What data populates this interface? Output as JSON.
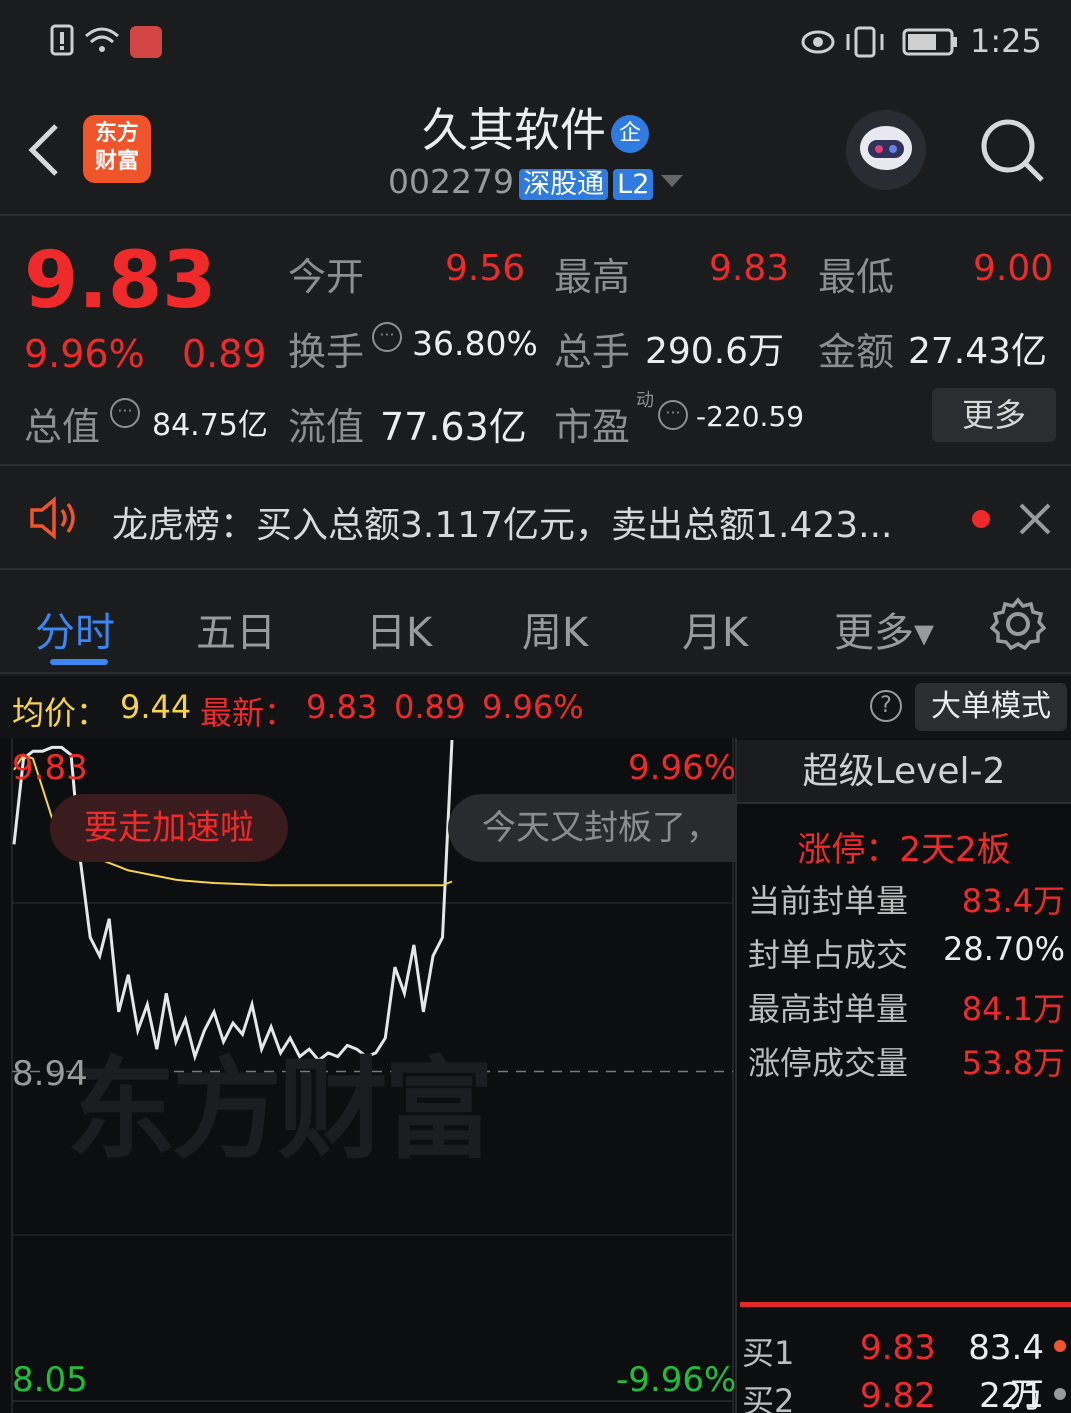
{
  "status_bar": {
    "time": "1:25"
  },
  "header": {
    "back_label": "<",
    "logo_text": [
      "东方",
      "财富"
    ],
    "stock_name": "久其软件",
    "enterprise_badge": "企",
    "stock_code": "002279",
    "connect_tag": "深股通",
    "level_tag": "L2"
  },
  "quote": {
    "price": "9.83",
    "change_pct": "9.96%",
    "change_amt": "0.89",
    "open_label": "今开",
    "open": "9.56",
    "high_label": "最高",
    "high": "9.83",
    "low_label": "最低",
    "low": "9.00",
    "turnover_label": "换手",
    "turnover": "36.80%",
    "volume_label": "总手",
    "volume": "290.6万",
    "amount_label": "金额",
    "amount": "27.43亿",
    "mcap_label": "总值",
    "mcap": "84.75亿",
    "float_label": "流值",
    "float": "77.63亿",
    "pe_label": "市盈",
    "pe_sup": "动",
    "pe": "-220.59",
    "more_button": "更多"
  },
  "news": {
    "text": "龙虎榜：买入总额3.117亿元，卖出总额1.423..."
  },
  "tabs": [
    "分时",
    "五日",
    "日K",
    "周K",
    "月K",
    "更多▾"
  ],
  "infobar": {
    "avg_label": "均价：",
    "avg": "9.44",
    "latest_label": "最新：",
    "latest": "9.83",
    "latest_chg": "0.89",
    "latest_pct": "9.96%",
    "help": "?",
    "big_order_button": "大单模式"
  },
  "chart": {
    "top_price": "9.83",
    "top_pct": "9.96%",
    "mid_price": "8.94",
    "bottom_price": "8.05",
    "bottom_pct": "-9.96%",
    "watermark": "东方财富",
    "bubble_left": "要走加速啦",
    "bubble_right": "今天又封板了，"
  },
  "chart_data": {
    "type": "line",
    "ylim": [
      8.05,
      9.83
    ],
    "series": [
      {
        "values": [
          9.55,
          9.78,
          9.8,
          9.8,
          9.81,
          9.81,
          9.79,
          9.5,
          9.3,
          9.25,
          9.35,
          9.1,
          9.2,
          9.05,
          9.12,
          9.0,
          9.15,
          9.02,
          9.08,
          8.98,
          9.05,
          9.1,
          9.02,
          9.07,
          9.04,
          9.12,
          9.0,
          9.06,
          8.99,
          9.03,
          8.98,
          9.0,
          8.97,
          8.99,
          8.98,
          9.01,
          9.0,
          8.98,
          8.99,
          9.03,
          9.22,
          9.15,
          9.28,
          9.1,
          9.25,
          9.3,
          9.83
        ]
      },
      {
        "values": [
          9.75,
          9.79,
          9.78,
          9.7,
          9.62,
          9.58,
          9.55,
          9.53,
          9.52,
          9.51,
          9.5,
          9.49,
          9.48,
          9.475,
          9.47,
          9.465,
          9.46,
          9.455,
          9.452,
          9.45,
          9.448,
          9.446,
          9.445,
          9.444,
          9.443,
          9.442,
          9.441,
          9.44,
          9.44,
          9.44,
          9.44,
          9.44,
          9.44,
          9.44,
          9.44,
          9.44,
          9.44,
          9.44,
          9.44,
          9.44,
          9.44,
          9.44,
          9.44,
          9.44,
          9.44,
          9.44,
          9.45
        ]
      }
    ]
  },
  "level2": {
    "title": "超级Level-2",
    "limit_label": "涨停：",
    "limit_value": "2天2板",
    "rows": [
      {
        "label": "当前封单量",
        "value": "83.4万"
      },
      {
        "label": "封单占成交",
        "value": "28.70%"
      },
      {
        "label": "最高封单量",
        "value": "84.1万"
      },
      {
        "label": "涨停成交量",
        "value": "53.8万"
      }
    ],
    "bids": [
      {
        "label": "买1",
        "price": "9.83",
        "qty": "83.4万"
      },
      {
        "label": "买2",
        "price": "9.82",
        "qty": "221"
      }
    ],
    "colors": {
      "up": "#f02a2a",
      "down": "#1fbf3a",
      "accent": "#2f7be0",
      "avg_line": "#f5d44a"
    }
  }
}
